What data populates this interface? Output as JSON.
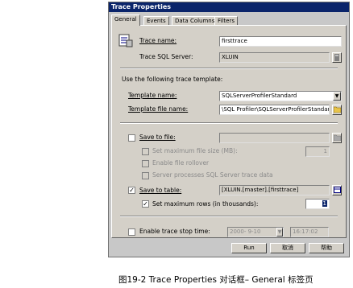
{
  "window": {
    "title": "Trace Properties"
  },
  "tabs": [
    "General",
    "Events",
    "Data Columns",
    "Filters"
  ],
  "general": {
    "trace_name_label": "Trace name:",
    "trace_name_value": "firsttrace",
    "trace_server_label": "Trace SQL Server:",
    "trace_server_value": "XLUIN",
    "template_hint": "Use the following trace template:",
    "template_name_label": "Template name:",
    "template_name_value": "SQLServerProfilerStandard",
    "template_file_label": "Template file name:",
    "template_file_value": "\\SQL Profiler\\SQLServerProfilerStandard.tdf",
    "save_to_file_label": "Save to file:",
    "set_max_file_size_label": "Set maximum file size (MB):",
    "max_file_size_value": "1",
    "enable_rollover_label": "Enable file rollover",
    "server_processes_label": "Server processes SQL Server trace data",
    "save_to_table_label": "Save to table:",
    "save_to_table_value": "[XLUIN.[master].[firsttrace]",
    "set_max_rows_label": "Set maximum rows (in thousands):",
    "max_rows_value": "1",
    "stop_time_label": "Enable trace stop time:",
    "stop_date_value": "2000- 9-10",
    "stop_time_value": "16:17:02"
  },
  "buttons": {
    "run": "Run",
    "cancel": "取消",
    "help": "帮助"
  },
  "caption": "图19-2  Trace Properties 对话框– General  标签页"
}
